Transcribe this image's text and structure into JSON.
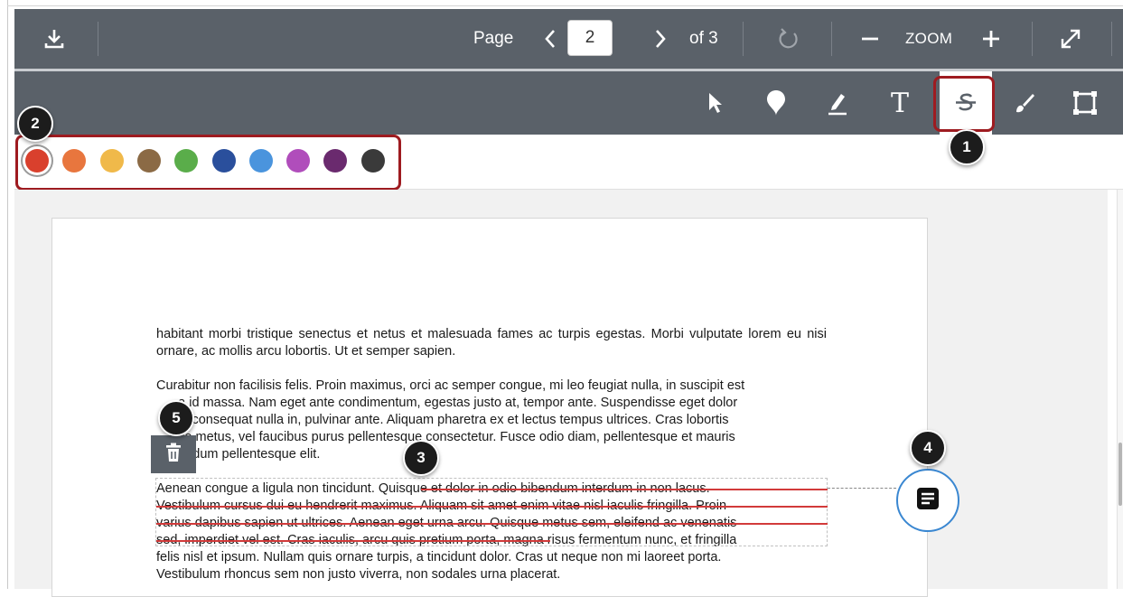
{
  "toolbar": {
    "page_label": "Page",
    "page_value": "2",
    "of_label": "of 3",
    "zoom_label": "ZOOM"
  },
  "icons": {
    "download": "download-icon",
    "prev": "chevron-left-icon",
    "next": "chevron-right-icon",
    "rotate": "rotate-icon",
    "zoom_out": "minus-icon",
    "zoom_in": "plus-icon",
    "fullscreen": "expand-icon",
    "select": "pointer-icon",
    "point": "pin-icon",
    "highlight": "highlighter-icon",
    "text": "text-icon",
    "strikeout": "strikethrough-icon",
    "draw": "brush-icon",
    "area": "area-box-icon",
    "delete": "trash-icon",
    "comment": "comment-icon"
  },
  "annotation_tools": {
    "text_glyph": "T"
  },
  "colors": [
    "#d9402d",
    "#e8763e",
    "#f0b94a",
    "#8b6a45",
    "#5aad4a",
    "#2a4f9c",
    "#4a94dd",
    "#b04dbb",
    "#6a2a6e",
    "#3a3a3a"
  ],
  "selected_color": "#d9402d",
  "callouts": [
    "1",
    "2",
    "3",
    "4",
    "5"
  ],
  "document": {
    "para1": "habitant morbi tristique senectus et netus et malesuada fames ac turpis egestas. Morbi vulputate lorem eu nisi ornare, ac mollis arcu lobortis. Ut et semper sapien.",
    "para2_line1": "Curabitur non facilisis felis. Proin maximus, orci ac semper congue, mi leo feugiat nulla, in suscipit est",
    "para2_line2": "      a id massa. Nam eget ante condimentum, egestas justo at, tempor ante. Suspendisse eget dolor",
    "para2_line3": "      it, consequat nulla in, pulvinar ante. Aliquam pharetra ex et lectus tempus ultrices. Cras lobortis",
    "para2_line4": "      tie metus, vel faucibus purus pellentesque consectetur. Fusce odio diam, pellentesque et mauris",
    "para2_line5": "      endum pellentesque elit.",
    "para3_line1a": "Aenean congue a ligula non tincidunt.",
    "para3_line1b": " Quisque et dolor in odio bibendum interdum in non lacus.",
    "para3_line2": "Vestibulum cursus dui eu hendrerit maximus. Aliquam sit amet enim vitae nisl iaculis fringilla. Proin",
    "para3_line3": "varius dapibus sapien ut ultrices. Aenean eget urna arcu. Quisque metus sem, eleifend ac venenatis",
    "para3_line4a": "sed, imperdiet vel est. Cras iaculis, arcu quis pretium porta,",
    "para3_line4b": " magna risus fermentum nunc, et fringilla",
    "para3_line5": "felis nisl et ipsum. Nullam quis ornare turpis, a tincidunt dolor. Cras ut neque non mi laoreet porta.",
    "para3_line6": "Vestibulum rhoncus sem non justo viverra, non sodales urna placerat."
  }
}
